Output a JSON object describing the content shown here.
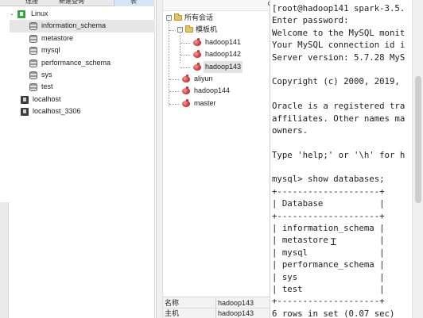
{
  "navicat": {
    "toolbar": {
      "buttons": [
        "连接",
        "新建查询",
        "表"
      ]
    },
    "tree": [
      {
        "label": "Linux",
        "kind": "connection-open",
        "level": 0
      },
      {
        "label": "information_schema",
        "kind": "database",
        "level": 1,
        "selected": true
      },
      {
        "label": "metastore",
        "kind": "database",
        "level": 1
      },
      {
        "label": "mysql",
        "kind": "database",
        "level": 1
      },
      {
        "label": "performance_schema",
        "kind": "database",
        "level": 1
      },
      {
        "label": "sys",
        "kind": "database",
        "level": 1
      },
      {
        "label": "test",
        "kind": "database",
        "level": 1
      },
      {
        "label": "localhost",
        "kind": "connection",
        "level": 0
      },
      {
        "label": "localhost_3306",
        "kind": "connection",
        "level": 0
      }
    ]
  },
  "sessions": {
    "search_icon": "search-icon",
    "root": "所有会话",
    "folder": "模板机",
    "folder_children": [
      "hadoop141",
      "hadoop142",
      "hadoop143"
    ],
    "selected": "hadoop143",
    "others": [
      "aliyun",
      "hadoop144",
      "master"
    ],
    "properties": [
      {
        "key": "名称",
        "value": "hadoop143"
      },
      {
        "key": "主机",
        "value": "hadoop143"
      }
    ]
  },
  "terminal": {
    "lines": [
      "[root@hadoop141 spark-3.5.",
      "Enter password:",
      "Welcome to the MySQL monit",
      "Your MySQL connection id i",
      "Server version: 5.7.28 MyS",
      "",
      "Copyright (c) 2000, 2019,",
      "",
      "Oracle is a registered tra",
      "affiliates. Other names ma",
      "owners.",
      "",
      "Type 'help;' or '\\h' for h",
      "",
      "mysql> show databases;",
      "+--------------------+",
      "| Database           |",
      "+--------------------+",
      "| information_schema |",
      "| metastore          |",
      "| mysql              |",
      "| performance_schema |",
      "| sys                |",
      "| test               |",
      "+--------------------+",
      "6 rows in set (0.07 sec)"
    ]
  }
}
